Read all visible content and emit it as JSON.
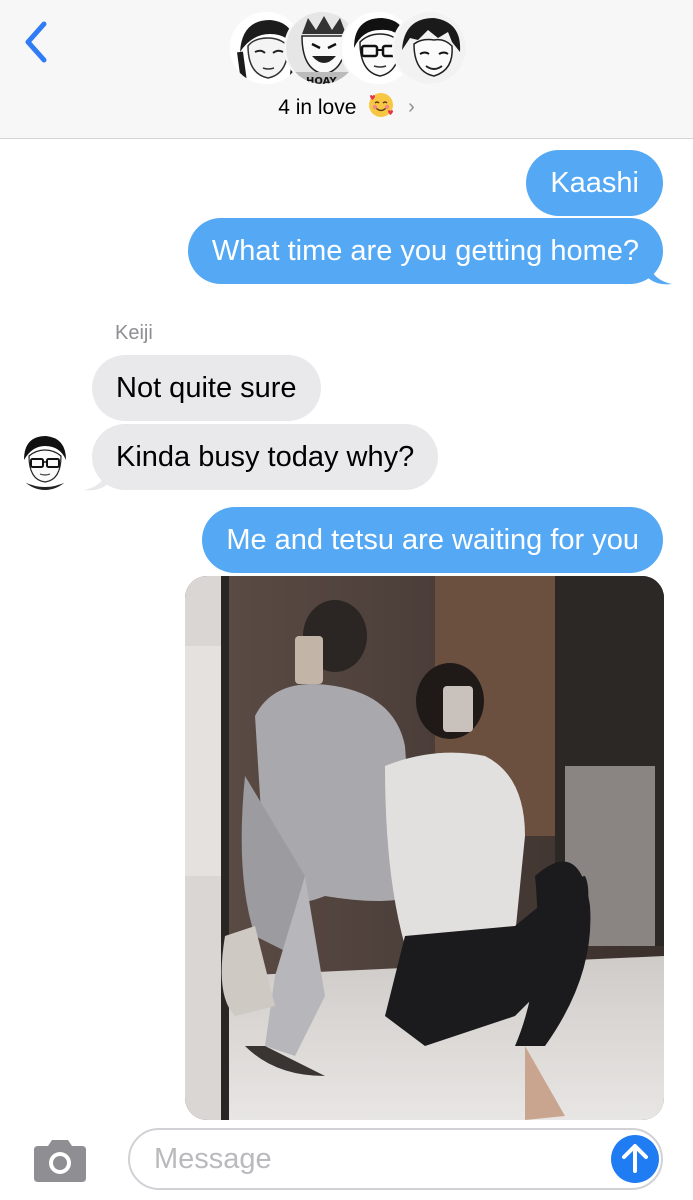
{
  "header": {
    "group_name": "4 in love",
    "emoji": "🥰",
    "avatar_icons": [
      "avatar-1",
      "avatar-2",
      "avatar-3",
      "avatar-4"
    ]
  },
  "messages": [
    {
      "direction": "outgoing",
      "text": "Kaashi"
    },
    {
      "direction": "outgoing",
      "text": "What time are you getting home?"
    },
    {
      "direction": "incoming",
      "sender": "Keiji",
      "text": "Not quite sure"
    },
    {
      "direction": "incoming",
      "text": "Kinda busy today why?"
    },
    {
      "direction": "outgoing",
      "text": "Me and tetsu are waiting for you"
    },
    {
      "direction": "outgoing",
      "type": "photo"
    }
  ],
  "composer": {
    "placeholder": "Message"
  },
  "colors": {
    "outgoing_bubble": "#55a9f4",
    "incoming_bubble": "#e9e9eb",
    "accent": "#1f7cf2",
    "header_bg": "#f7f7f7"
  }
}
